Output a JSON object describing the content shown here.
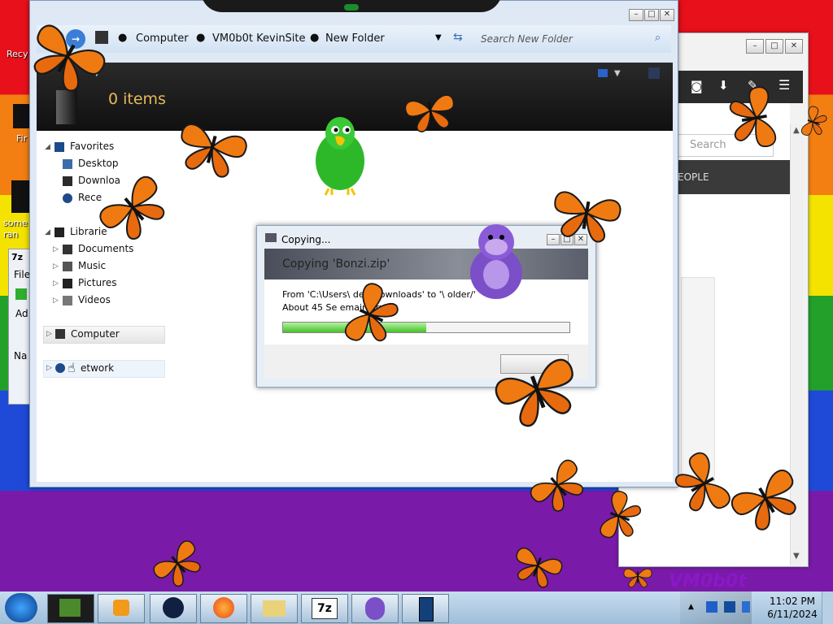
{
  "desktop": {
    "icons": [
      {
        "label": "Recy"
      },
      {
        "label": "Fir"
      },
      {
        "label": "some ran"
      }
    ]
  },
  "explorer": {
    "breadcrumb": [
      "Computer",
      "VM0b0t KevinSite",
      "New Folder"
    ],
    "search_placeholder": "Search New Folder",
    "item_count": "0 items",
    "nav": {
      "favorites": "Favorites",
      "desktop": "Desktop",
      "downloads": "Downloa",
      "recent": "Rece",
      "libraries": "Librarie",
      "documents": "Documents",
      "music": "Music",
      "pictures": "Pictures",
      "videos": "Videos",
      "computer": "Computer",
      "network": "etwork"
    }
  },
  "copy_dialog": {
    "title": "Copying...",
    "header": "Copying 'Bonzi.zip'",
    "from_line": "From 'C:\\Users\\ den\\Downloads' to '\\ older/'",
    "time_line": "About 45 Se emaining",
    "progress_pct": 0.5
  },
  "browser": {
    "search_placeholder": "Search",
    "nav_label": "EOPLE"
  },
  "seven_zip": {
    "label": "7z",
    "file_menu": "File",
    "add_label": "Ad",
    "name_col": "Na"
  },
  "taskbar": {
    "time": "11:02 PM",
    "date": "6/11/2024",
    "seven_zip_label": "7z",
    "watermark": "VM0b0t"
  }
}
